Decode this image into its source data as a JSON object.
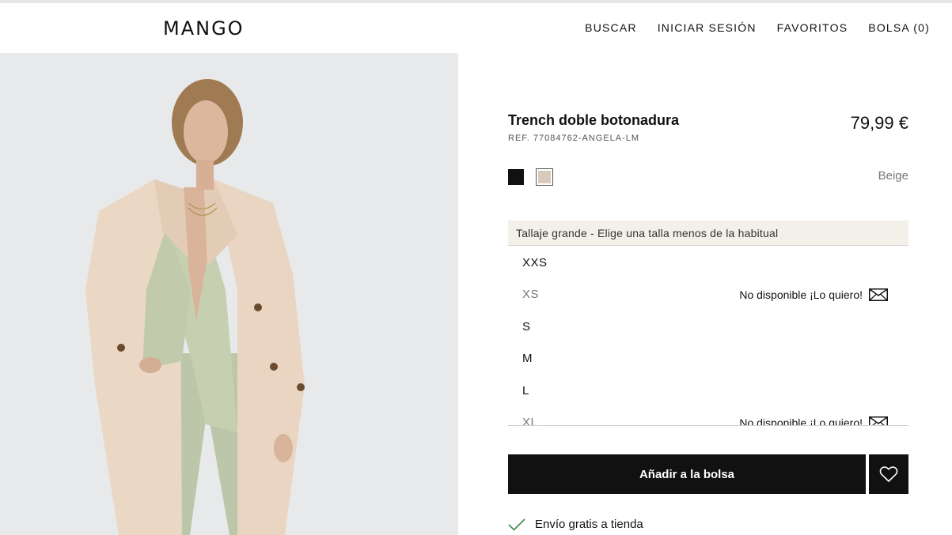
{
  "brand": {
    "logo": "MANGO"
  },
  "nav": {
    "search": "BUSCAR",
    "login": "INICIAR SESIÓN",
    "favorites": "FAVORITOS",
    "bag": "BOLSA (0)"
  },
  "product": {
    "name": "Trench doble botonadura",
    "ref": "REF. 77084762-ANGELA-LM",
    "price": "79,99 €",
    "selected_color": "Beige",
    "colors": [
      {
        "name": "black",
        "hex": "#111111"
      },
      {
        "name": "beige",
        "hex": "#d8cabb"
      }
    ]
  },
  "sizing": {
    "notice": "Tallaje grande - Elige una talla menos de la habitual",
    "sizes": [
      {
        "label": "XXS",
        "available": true
      },
      {
        "label": "XS",
        "available": false,
        "note": "No disponible ¡Lo quiero!"
      },
      {
        "label": "S",
        "available": true
      },
      {
        "label": "M",
        "available": true
      },
      {
        "label": "L",
        "available": true
      },
      {
        "label": "XL",
        "available": false,
        "note": "No disponible ¡Lo quiero!"
      }
    ]
  },
  "actions": {
    "add_to_bag": "Añadir a la bolsa"
  },
  "shipping": {
    "text": "Envío gratis a tienda"
  },
  "colors": {
    "accent_dark": "#111111",
    "notice_bg": "#f3f0ea",
    "check_green": "#3a8a4a"
  }
}
